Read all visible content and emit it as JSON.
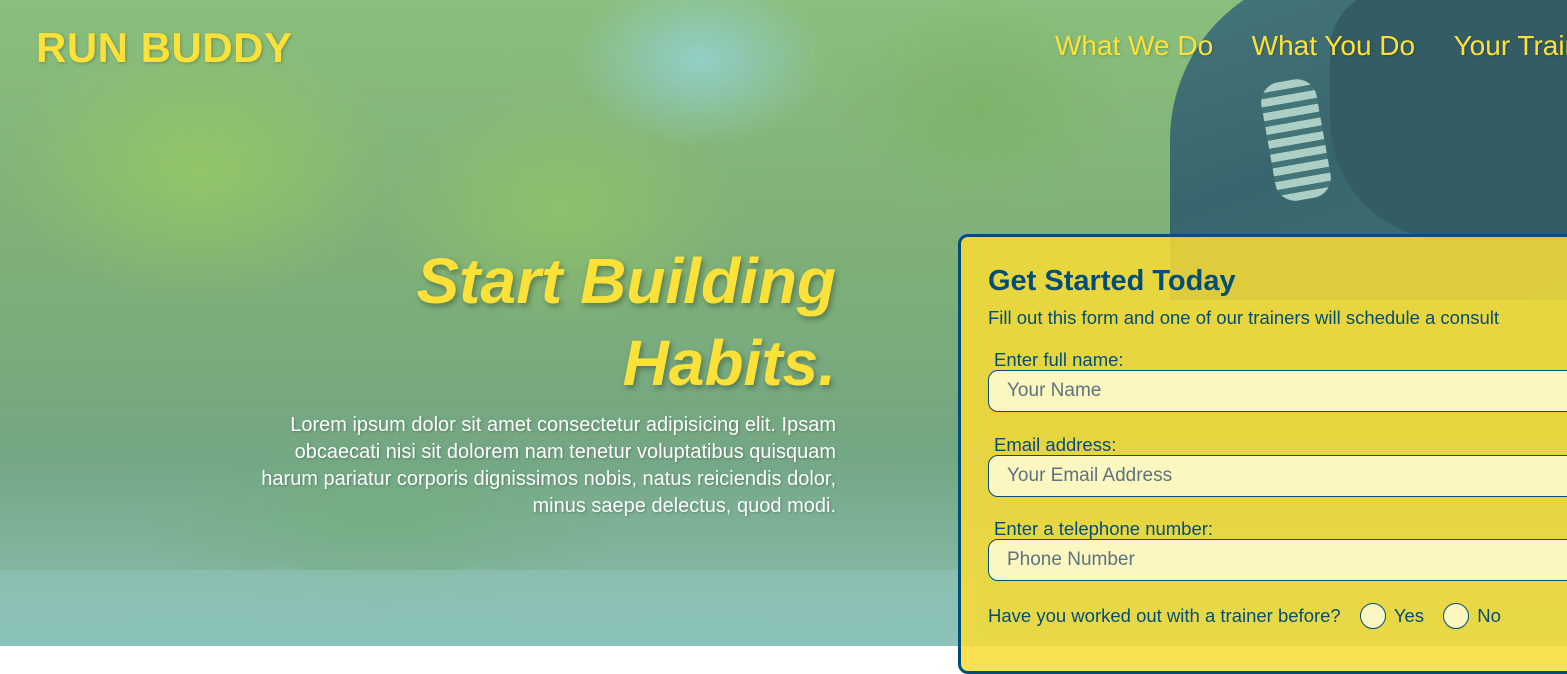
{
  "header": {
    "logo": "RUN BUDDY",
    "nav": [
      {
        "label": "What We Do"
      },
      {
        "label": "What You Do"
      },
      {
        "label": "Your Trainers"
      }
    ]
  },
  "hero": {
    "headline": "Start Building Habits.",
    "body": "Lorem ipsum dolor sit amet consectetur adipisicing elit. Ipsam obcaecati nisi sit dolorem nam tenetur voluptatibus quisquam harum pariatur corporis dignissimos nobis, natus reiciendis dolor, minus saepe delectus, quod modi."
  },
  "signup": {
    "title": "Get Started Today",
    "subtitle": "Fill out this form and one of our trainers will schedule a consult",
    "fields": [
      {
        "label": "Enter full name:",
        "placeholder": "Your Name",
        "value": ""
      },
      {
        "label": "Email address:",
        "placeholder": "Your Email Address",
        "value": ""
      },
      {
        "label": "Enter a telephone number:",
        "placeholder": "Phone Number",
        "value": ""
      }
    ],
    "trainer_question": "Have you worked out with a trainer before?",
    "options": [
      "Yes",
      "No"
    ]
  },
  "colors": {
    "accent": "#fce138",
    "primary": "#024e76",
    "text_light": "#ffffff"
  }
}
